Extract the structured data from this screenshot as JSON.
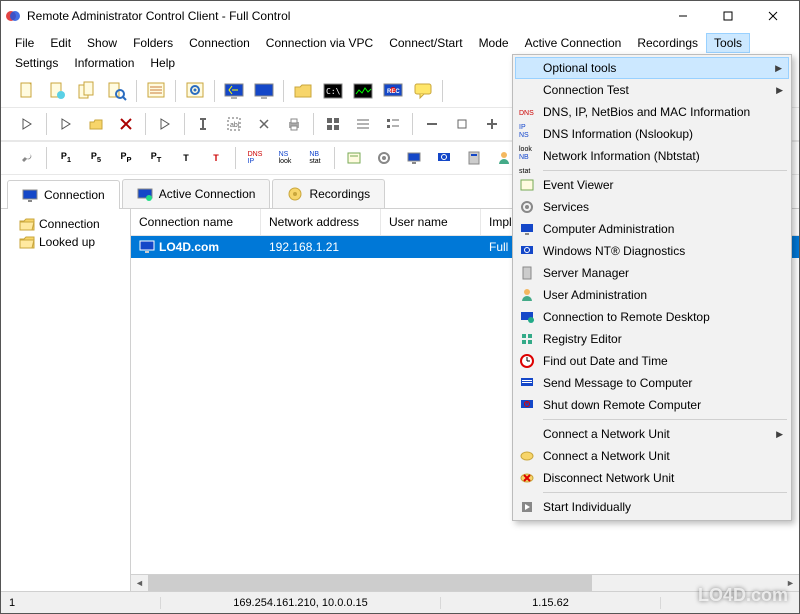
{
  "window": {
    "title": "Remote Administrator Control Client - Full Control"
  },
  "menubar": {
    "items": [
      "File",
      "Edit",
      "Show",
      "Folders",
      "Connection",
      "Connection via VPC",
      "Connect/Start",
      "Mode",
      "Active Connection",
      "Recordings",
      "Tools",
      "Settings",
      "Information",
      "Help"
    ],
    "active": "Tools"
  },
  "tabs": {
    "items": [
      {
        "label": "Connection",
        "active": true
      },
      {
        "label": "Active Connection",
        "active": false
      },
      {
        "label": "Recordings",
        "active": false
      }
    ]
  },
  "tree": {
    "items": [
      {
        "label": "Connection"
      },
      {
        "label": "Looked up"
      }
    ]
  },
  "list": {
    "columns": [
      "Connection name",
      "Network address",
      "User name",
      "Implicit conne"
    ],
    "rows": [
      {
        "name": "LO4D.com",
        "address": "192.168.1.21",
        "user": "",
        "implicit": "Full Control",
        "selected": true
      }
    ]
  },
  "statusbar": {
    "s1": "1",
    "s2": "169.254.161.210, 10.0.0.15",
    "s3": "1.15.62"
  },
  "dropdown": {
    "items": [
      {
        "label": "Optional tools",
        "icon": "",
        "sub": true,
        "hl": true
      },
      {
        "label": "Connection Test",
        "icon": "",
        "sub": true
      },
      {
        "label": "DNS, IP, NetBios and MAC Information",
        "icon": "dns-ip"
      },
      {
        "label": "DNS Information (Nslookup)",
        "icon": "ns-look"
      },
      {
        "label": "Network Information (Nbtstat)",
        "icon": "nb-stat"
      },
      {
        "sep": true
      },
      {
        "label": "Event Viewer",
        "icon": "event"
      },
      {
        "label": "Services",
        "icon": "services"
      },
      {
        "label": "Computer Administration",
        "icon": "admin"
      },
      {
        "label": "Windows NT® Diagnostics",
        "icon": "diag"
      },
      {
        "label": "Server Manager",
        "icon": "server"
      },
      {
        "label": "User Administration",
        "icon": "user"
      },
      {
        "label": "Connection to Remote Desktop",
        "icon": "rdp"
      },
      {
        "label": "Registry Editor",
        "icon": "reg"
      },
      {
        "label": "Find out Date and Time",
        "icon": "clock"
      },
      {
        "label": "Send Message to Computer",
        "icon": "msg"
      },
      {
        "label": "Shut down Remote Computer",
        "icon": "shutdown"
      },
      {
        "sep": true
      },
      {
        "label": "Connect a Network Unit",
        "icon": "",
        "sub": true
      },
      {
        "label": "Connect a Network Unit",
        "icon": "netc"
      },
      {
        "label": "Disconnect Network Unit",
        "icon": "netd"
      },
      {
        "sep": true
      },
      {
        "label": "Start Individually",
        "icon": "start"
      }
    ]
  },
  "watermark": "LO4D.com"
}
